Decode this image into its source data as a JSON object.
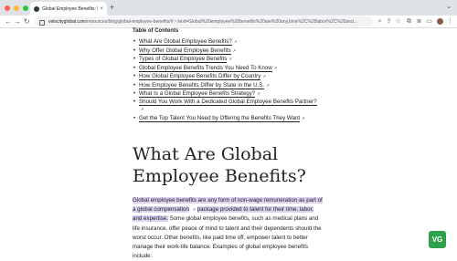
{
  "browser": {
    "tab": {
      "title": "Global Employee Benefits: Ho...",
      "close": "×"
    },
    "new_tab": "+",
    "tab_menu": "⌄",
    "nav": {
      "back": "←",
      "forward": "→",
      "reload": "↻"
    },
    "url_host": "velocityglobal.com",
    "url_path": "/resources/blog/global-employee-benefits/#:~:text=Global%20employee%20benefits%20are%20any,time%2C%20labor%2C%20and...",
    "toolbar": {
      "zoom": "⌕",
      "share": "⇪",
      "star": "☆",
      "extensions": "⧉",
      "reading": "≣",
      "split": "▭",
      "menu": "⋮"
    }
  },
  "toc": {
    "title": "Table of Contents",
    "items": [
      "What Are Global Employee Benefits?",
      "Why Offer Global Employee Benefits",
      "Types of Global Employee Benefits",
      "Global Employee Benefits Trends You Need To Know",
      "How Global Employee Benefits Differ by Country",
      "How Employee Benefits Differ by State in the U.S.",
      "What Is a Global Employee Benefits Strategy?",
      "Should You Work With a Dedicated Global Employee Benefits Partner?",
      "Get the Top Talent You Need by Offering the Benefits They Want"
    ],
    "ext_glyph": "↗"
  },
  "heading": "What Are Global Employee Benefits?",
  "paragraph": {
    "highlight_1": "Global employee benefits are any form of non-wage remuneration as part of a global compensation",
    "highlight_2": "package provided to talent for their time, labor, and expertise.",
    "rest": " Some global employee benefits, such as medical plans and life insurance, offer peace of mind to talent and their dependents should the worst occur. Other benefits, like paid time off, empower talent to better manage their work-life balance. Examples of global employee benefits include:"
  },
  "badge": "VG",
  "colors": {
    "highlight": "#dcd3f3",
    "badge": "#2da24a",
    "chrome": "#dfe3e8"
  }
}
